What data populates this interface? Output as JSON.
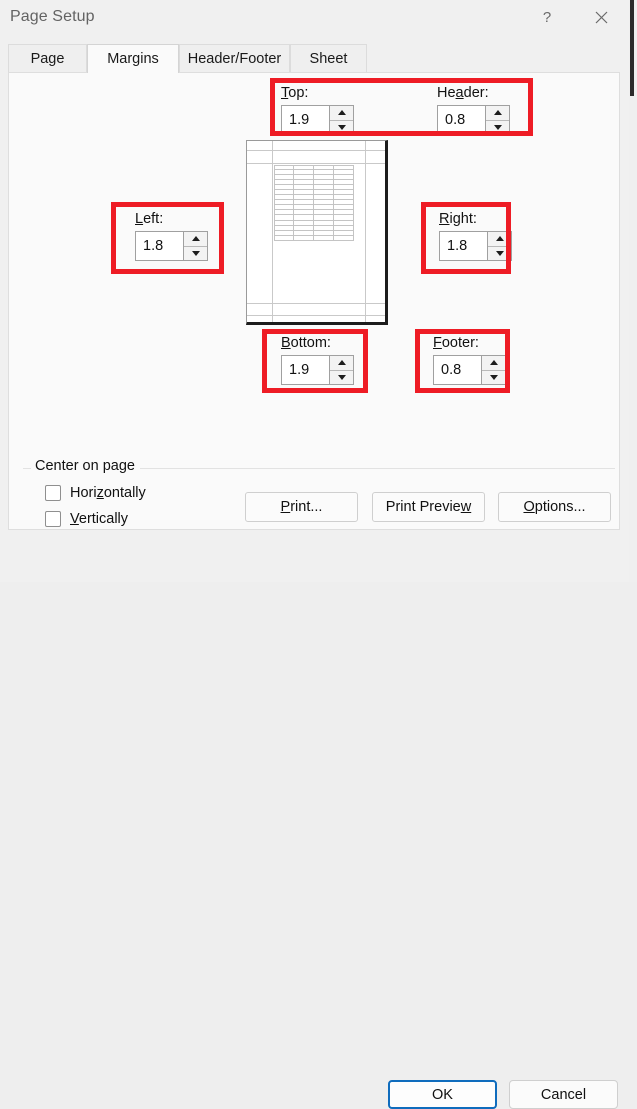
{
  "window": {
    "title": "Page Setup",
    "help_icon": "question-mark-icon",
    "close_icon": "close-icon"
  },
  "tabs": [
    {
      "label": "Page",
      "selected": false
    },
    {
      "label": "Margins",
      "selected": true
    },
    {
      "label": "Header/Footer",
      "selected": false
    },
    {
      "label": "Sheet",
      "selected": false
    }
  ],
  "margins": {
    "top": {
      "label_pre": "",
      "label_key": "T",
      "label_post": "op:",
      "value": "1.9"
    },
    "header": {
      "label_pre": "He",
      "label_key": "a",
      "label_post": "der:",
      "value": "0.8"
    },
    "left": {
      "label_pre": "",
      "label_key": "L",
      "label_post": "eft:",
      "value": "1.8"
    },
    "right": {
      "label_pre": "",
      "label_key": "R",
      "label_post": "ight:",
      "value": "1.8"
    },
    "bottom": {
      "label_pre": "",
      "label_key": "B",
      "label_post": "ottom:",
      "value": "1.9"
    },
    "footer": {
      "label_pre": "",
      "label_key": "F",
      "label_post": "ooter:",
      "value": "0.8"
    }
  },
  "center_on_page": {
    "group_label": "Center on page",
    "horizontally": {
      "pre": "Hori",
      "key": "z",
      "post": "ontally",
      "checked": false
    },
    "vertically": {
      "pre": "",
      "key": "V",
      "post": "ertically",
      "checked": false
    }
  },
  "buttons": {
    "print": {
      "pre": "",
      "key": "P",
      "post": "rint..."
    },
    "print_preview": {
      "pre": "Print Previe",
      "key": "w",
      "post": ""
    },
    "options": {
      "pre": "",
      "key": "O",
      "post": "ptions..."
    },
    "ok": "OK",
    "cancel": "Cancel"
  },
  "colors": {
    "annotation_red": "#ee1c25",
    "focus_blue": "#0f6cbd",
    "dialog_bg": "#f0f0f0",
    "panel_bg": "#fafafa"
  }
}
